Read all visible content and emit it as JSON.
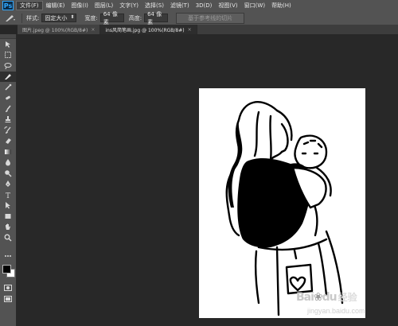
{
  "menubar": {
    "logo": "Ps",
    "items": [
      "文件(F)",
      "编辑(E)",
      "图像(I)",
      "图层(L)",
      "文字(Y)",
      "选择(S)",
      "滤镜(T)",
      "3D(D)",
      "视图(V)",
      "窗口(W)",
      "帮助(H)"
    ],
    "active_index": 0
  },
  "options": {
    "style_label": "样式:",
    "style_value": "固定大小",
    "width_label": "宽度:",
    "width_value": "64 像素",
    "height_label": "高度:",
    "height_value": "64 像素",
    "slice_button": "基于参考线的切片"
  },
  "tabs": [
    {
      "label": "图片.jpeg @ 100%(RGB/8#)",
      "close": "×",
      "active": false
    },
    {
      "label": "ins风简笔画.jpg @ 100%(RGB/8#)",
      "close": "×",
      "active": true
    }
  ],
  "toolbar": {
    "tools": [
      "move-tool-icon",
      "marquee-tool-icon",
      "lasso-tool-icon",
      "slice-tool-icon",
      "eyedropper-tool-icon",
      "healing-brush-icon",
      "brush-tool-icon",
      "clone-stamp-icon",
      "history-brush-icon",
      "eraser-tool-icon",
      "gradient-tool-icon",
      "blur-tool-icon",
      "dodge-tool-icon",
      "pen-tool-icon",
      "type-tool-icon",
      "path-selection-icon",
      "shape-tool-icon",
      "hand-tool-icon",
      "zoom-tool-icon"
    ],
    "active_index": 3,
    "foreground": "#000000",
    "background": "#ffffff"
  },
  "watermark": {
    "logo": "Bai",
    "logo_end": "du",
    "text": "经验",
    "url": "jingyan.baidu.com"
  }
}
